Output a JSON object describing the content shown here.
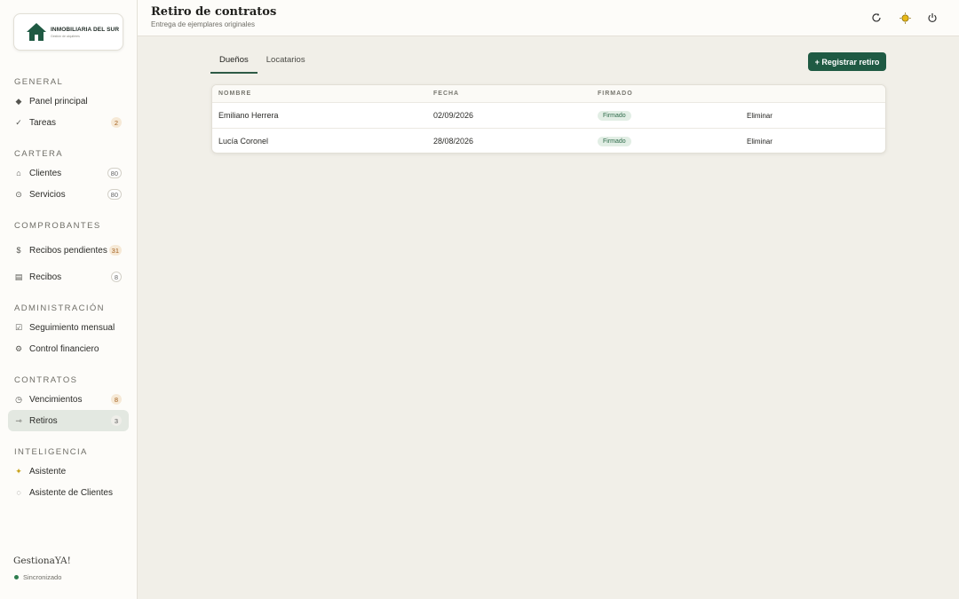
{
  "logo": {
    "name": "INMOBILIARIA DEL SUR",
    "tagline": "Gestión de alquileres"
  },
  "sidebar": {
    "sections": {
      "general": "GENERAL",
      "cartera": "CARTERA",
      "comprobantes": "COMPROBANTES",
      "administracion": "ADMINISTRACIÓN",
      "contratos": "CONTRATOS",
      "inteligencia": "INTELIGENCIA"
    },
    "items": {
      "panel": {
        "label": "Panel principal",
        "icon": "diamond-icon"
      },
      "tareas": {
        "label": "Tareas",
        "badge": "2",
        "icon": "check-icon"
      },
      "clientes": {
        "label": "Clientes",
        "badge": "80",
        "icon": "home-icon"
      },
      "servicios": {
        "label": "Servicios",
        "badge": "80",
        "icon": "service-icon"
      },
      "recibos_pend": {
        "label": "Recibos pendientes",
        "badge": "31",
        "icon": "dollar-icon"
      },
      "recibos": {
        "label": "Recibos",
        "badge": "8",
        "icon": "receipt-icon"
      },
      "seguimiento": {
        "label": "Seguimiento mensual",
        "icon": "checkbox-icon"
      },
      "control": {
        "label": "Control financiero",
        "icon": "gear-icon"
      },
      "vencimientos": {
        "label": "Vencimientos",
        "badge": "8",
        "icon": "clock-icon"
      },
      "retiros": {
        "label": "Retiros",
        "badge": "3",
        "icon": "arrow-icon"
      },
      "asistente": {
        "label": "Asistente",
        "icon": "sparkle-icon"
      },
      "asistente_clientes": {
        "label": "Asistente de Clientes",
        "icon": "chat-icon"
      }
    },
    "brand": "GestionaYA!",
    "sync_status": "Sincronizado"
  },
  "header": {
    "title": "Retiro de contratos",
    "subtitle": "Entrega de ejemplares originales"
  },
  "tabs": {
    "owners": "Dueños",
    "tenants": "Locatarios"
  },
  "actions": {
    "register": "+ Registrar retiro"
  },
  "table": {
    "columns": {
      "name": "NOMBRE",
      "date": "FECHA",
      "signed": "FIRMADO"
    },
    "rows": [
      {
        "name": "Emiliano Herrera",
        "date": "02/09/2026",
        "status": "Firmado",
        "action": "Eliminar"
      },
      {
        "name": "Lucía Coronel",
        "date": "28/08/2026",
        "status": "Firmado",
        "action": "Eliminar"
      }
    ]
  },
  "colors": {
    "accent": "#1f5a43",
    "active_nav": "#e3e8e1",
    "pill_bg": "#e2eee5",
    "warning_badge": "#f6e9d6"
  }
}
